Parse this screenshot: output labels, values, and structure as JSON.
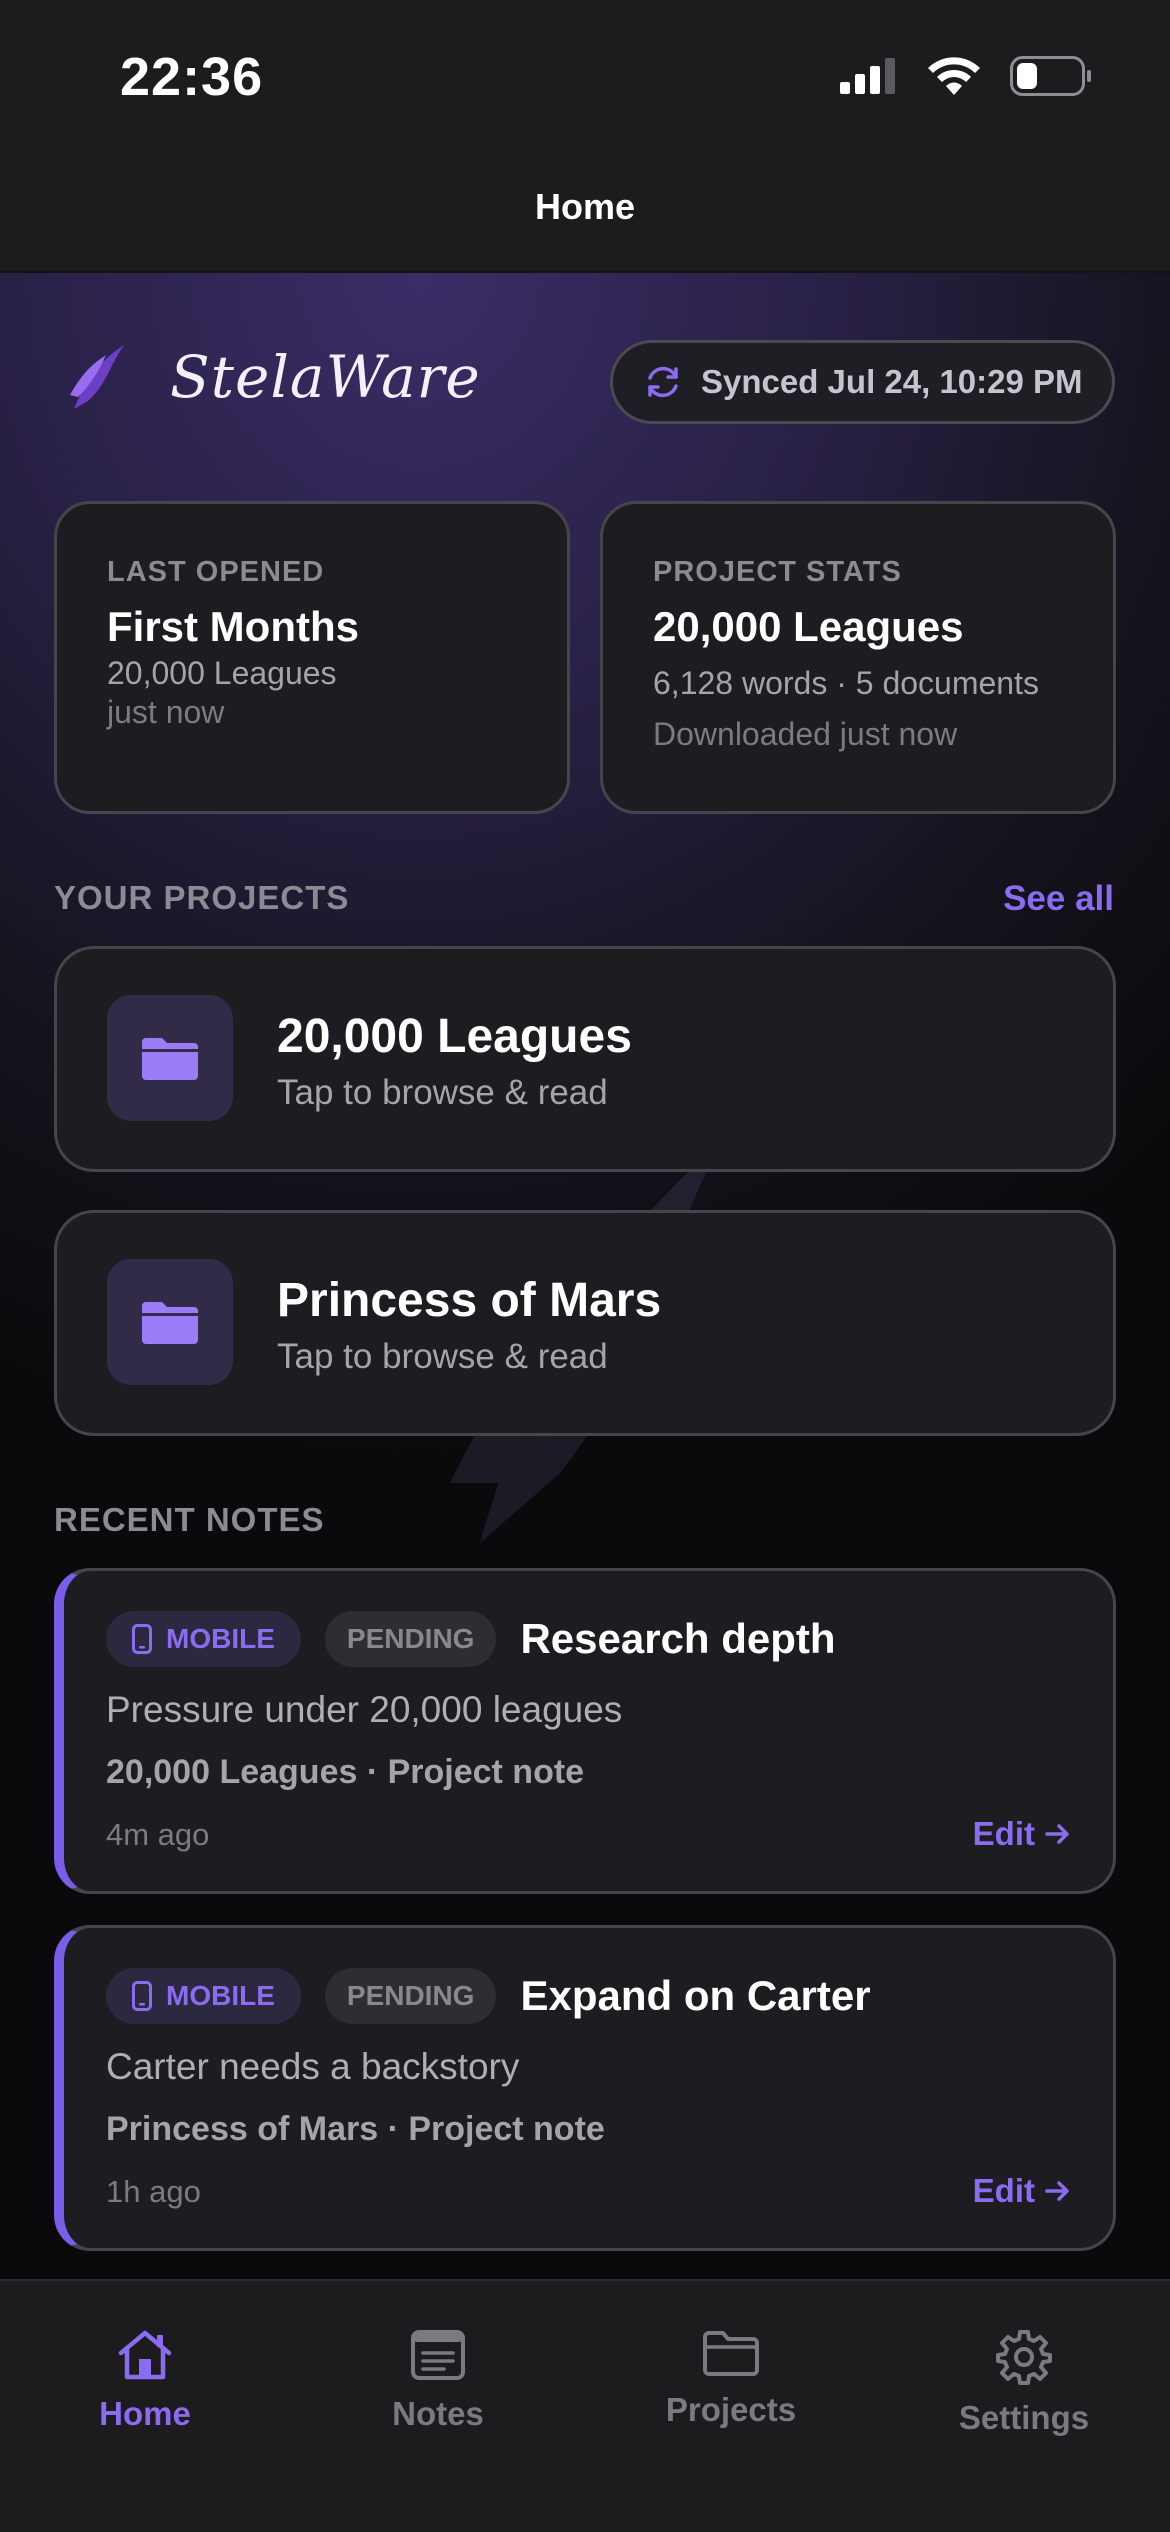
{
  "status_bar": {
    "time": "22:36"
  },
  "nav": {
    "title": "Home"
  },
  "brand": {
    "name": "StelaWare"
  },
  "sync": {
    "label": "Synced Jul 24, 10:29 PM"
  },
  "last_opened": {
    "eyebrow": "LAST OPENED",
    "title": "First Months",
    "project": "20,000 Leagues",
    "time": "just now"
  },
  "project_stats": {
    "eyebrow": "PROJECT STATS",
    "title": "20,000 Leagues",
    "summary": "6,128 words · 5 documents",
    "downloaded": "Downloaded just now"
  },
  "projects": {
    "label": "YOUR PROJECTS",
    "see_all": "See all",
    "items": [
      {
        "title": "20,000 Leagues",
        "subtitle": "Tap to browse & read"
      },
      {
        "title": "Princess of Mars",
        "subtitle": "Tap to browse & read"
      }
    ]
  },
  "notes": {
    "label": "RECENT NOTES",
    "items": [
      {
        "source": "MOBILE",
        "status": "PENDING",
        "title": "Research depth",
        "body": "Pressure under 20,000 leagues",
        "meta": "20,000 Leagues · Project note",
        "time": "4m ago",
        "action": "Edit"
      },
      {
        "source": "MOBILE",
        "status": "PENDING",
        "title": "Expand on Carter",
        "body": "Carter needs a backstory",
        "meta": "Princess of Mars · Project note",
        "time": "1h ago",
        "action": "Edit"
      }
    ]
  },
  "tabs": [
    {
      "label": "Home",
      "icon": "home-icon",
      "active": true
    },
    {
      "label": "Notes",
      "icon": "notes-icon",
      "active": false
    },
    {
      "label": "Projects",
      "icon": "folder-icon",
      "active": false
    },
    {
      "label": "Settings",
      "icon": "gear-icon",
      "active": false
    }
  ],
  "colors": {
    "accent": "#8b6cf0",
    "card": "#1d1c21",
    "background": "#1c1c1e"
  }
}
